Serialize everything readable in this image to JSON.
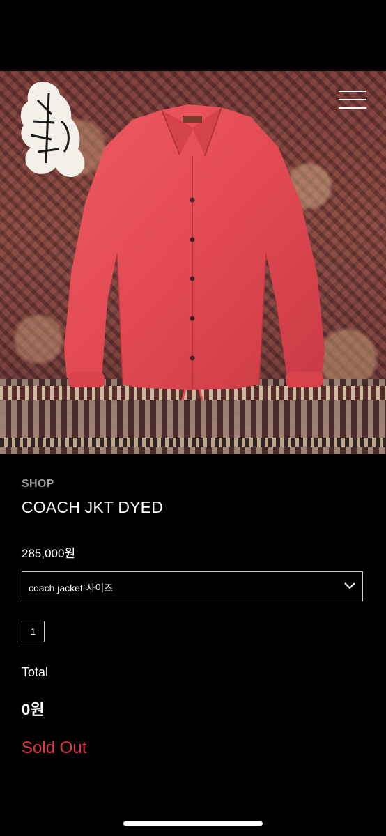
{
  "breadcrumb": "SHOP",
  "product": {
    "title": "COACH JKT DYED",
    "price": "285,000원"
  },
  "option_select": {
    "value": "coach jacket-사이즈"
  },
  "quantity": "1",
  "total": {
    "label": "Total",
    "value": "0원"
  },
  "status": "Sold Out",
  "colors": {
    "background": "#000000",
    "jacket": "#e44c55",
    "sold_out": "#e0393f",
    "muted": "#9a9a9a"
  },
  "icons": [
    "brand-logo-icon",
    "menu-icon",
    "chevron-down-icon"
  ]
}
